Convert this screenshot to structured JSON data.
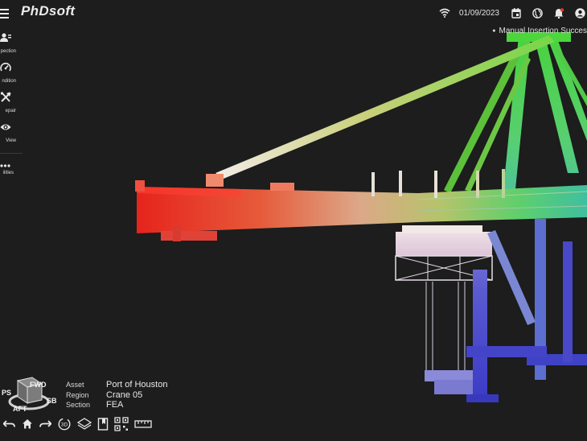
{
  "app": {
    "logo_text": "PhDsoft"
  },
  "header": {
    "date": "01/09/2023",
    "icons": [
      "wifi-icon",
      "calendar-icon",
      "globe-icon",
      "bell-icon",
      "user-icon"
    ],
    "notification_text": "Manual Insertion Succes"
  },
  "sidebar": {
    "items": [
      {
        "id": "inspection",
        "label": "pection",
        "icon": "inspector-icon"
      },
      {
        "id": "condition",
        "label": "ndition",
        "icon": "gauge-icon"
      },
      {
        "id": "repair",
        "label": "epair",
        "icon": "tools-icon"
      },
      {
        "id": "view",
        "label": "View",
        "icon": "eye-icon"
      }
    ],
    "facilities": {
      "label": "ilities",
      "icon": "more-icon"
    }
  },
  "orientation": {
    "fwd": "FWD",
    "aft": "AFT",
    "ps": "PS",
    "sb": "SB"
  },
  "info": {
    "asset_label": "Asset",
    "asset_value": "Port of Houston",
    "region_label": "Region",
    "region_value": "Crane 05",
    "section_label": "Section",
    "section_value": "FEA"
  },
  "toolbar": {
    "items": [
      "undo-icon",
      "home-icon",
      "redo-icon",
      "rotate-3d-icon",
      "layers-icon",
      "bookmark-icon",
      "qr-code-icon",
      "ruler-icon"
    ],
    "rotate_label": "3D"
  },
  "colors": {
    "accent_red": "#e6221c",
    "accent_green": "#52d444",
    "accent_blue": "#3c3cc4",
    "background": "#1c1d1c"
  }
}
